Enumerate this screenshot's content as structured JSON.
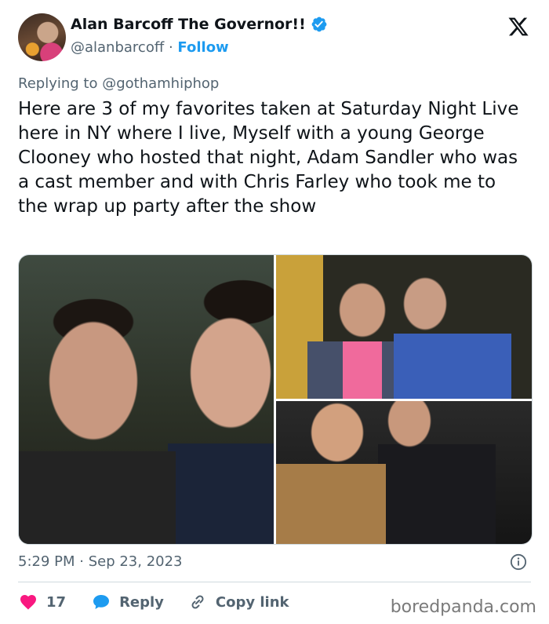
{
  "author": {
    "display_name": "Alan Barcoff The Governor!!",
    "handle": "@alanbarcoff",
    "separator": " · ",
    "follow_label": "Follow",
    "verified": true
  },
  "brand": {
    "logo_icon": "x-logo-icon"
  },
  "reply_context": "Replying to @gothamhiphop",
  "tweet_text": "Here are 3 of my favorites taken at Saturday Night Live here in NY where I live, Myself with a young George Clooney who hosted that night, Adam Sandler who was a cast member and with Chris Farley who took me to the wrap up party after the show",
  "media": {
    "photos": [
      {
        "name": "photo-clooney",
        "description_icon": "photo"
      },
      {
        "name": "photo-sandler",
        "description_icon": "photo"
      },
      {
        "name": "photo-farley",
        "description_icon": "photo"
      }
    ]
  },
  "timestamp": "5:29 PM · Sep 23, 2023",
  "actions": {
    "like_count": "17",
    "reply_label": "Reply",
    "copy_link_label": "Copy link"
  },
  "colors": {
    "accent": "#1d9bf0",
    "like": "#f91880",
    "text": "#0f1419",
    "secondary": "#536471"
  },
  "watermark": "boredpanda.com"
}
